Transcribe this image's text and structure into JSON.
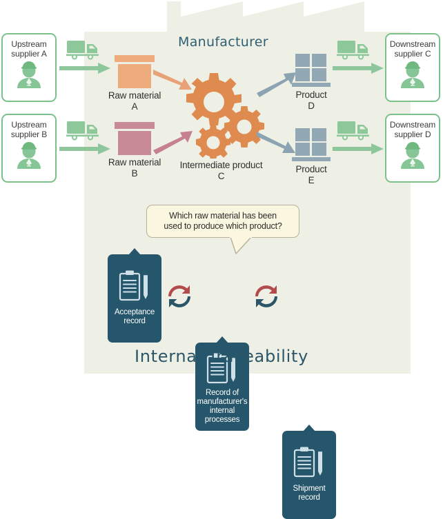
{
  "diagram": {
    "title": "Internal Traceability",
    "manufacturer_label": "Manufacturer",
    "question_bubble": "Which raw material has been\nused to produce which product?",
    "colors": {
      "factory_bg": "#eef0e5",
      "supplier_green": "#7cc08a",
      "person_green": "#86c596",
      "truck_green": "#8cc89a",
      "arrow_green": "#8ec79c",
      "raw_material_a": "#eeab7c",
      "raw_material_b": "#c78a96",
      "product_blue": "#92a8b4",
      "record_card": "#26566b",
      "title_teal": "#2b5668",
      "bubble_fill": "#fbf6e0",
      "bubble_border": "#b7b09a",
      "cycle_red": "#b34a4c",
      "cycle_teal": "#2b5668",
      "gear_orange": "#df8b4f"
    }
  },
  "upstream_suppliers": [
    {
      "label": "Upstream\nsupplier A",
      "name": "upstream-supplier-a"
    },
    {
      "label": "Upstream\nsupplier B",
      "name": "upstream-supplier-b"
    }
  ],
  "downstream_suppliers": [
    {
      "label": "Downstream\nsupplier C",
      "name": "downstream-supplier-c"
    },
    {
      "label": "Downstream\nsupplier D",
      "name": "downstream-supplier-d"
    }
  ],
  "raw_materials": [
    {
      "label": "Raw material\nA"
    },
    {
      "label": "Raw material\nB"
    }
  ],
  "intermediate": {
    "label": "Intermediate product\nC"
  },
  "products": [
    {
      "label": "Product\nD"
    },
    {
      "label": "Product\nE"
    }
  ],
  "records": [
    {
      "label": "Acceptance\nrecord"
    },
    {
      "label": "Record of\nmanufacturer's\ninternal\nprocesses"
    },
    {
      "label": "Shipment\nrecord"
    }
  ]
}
